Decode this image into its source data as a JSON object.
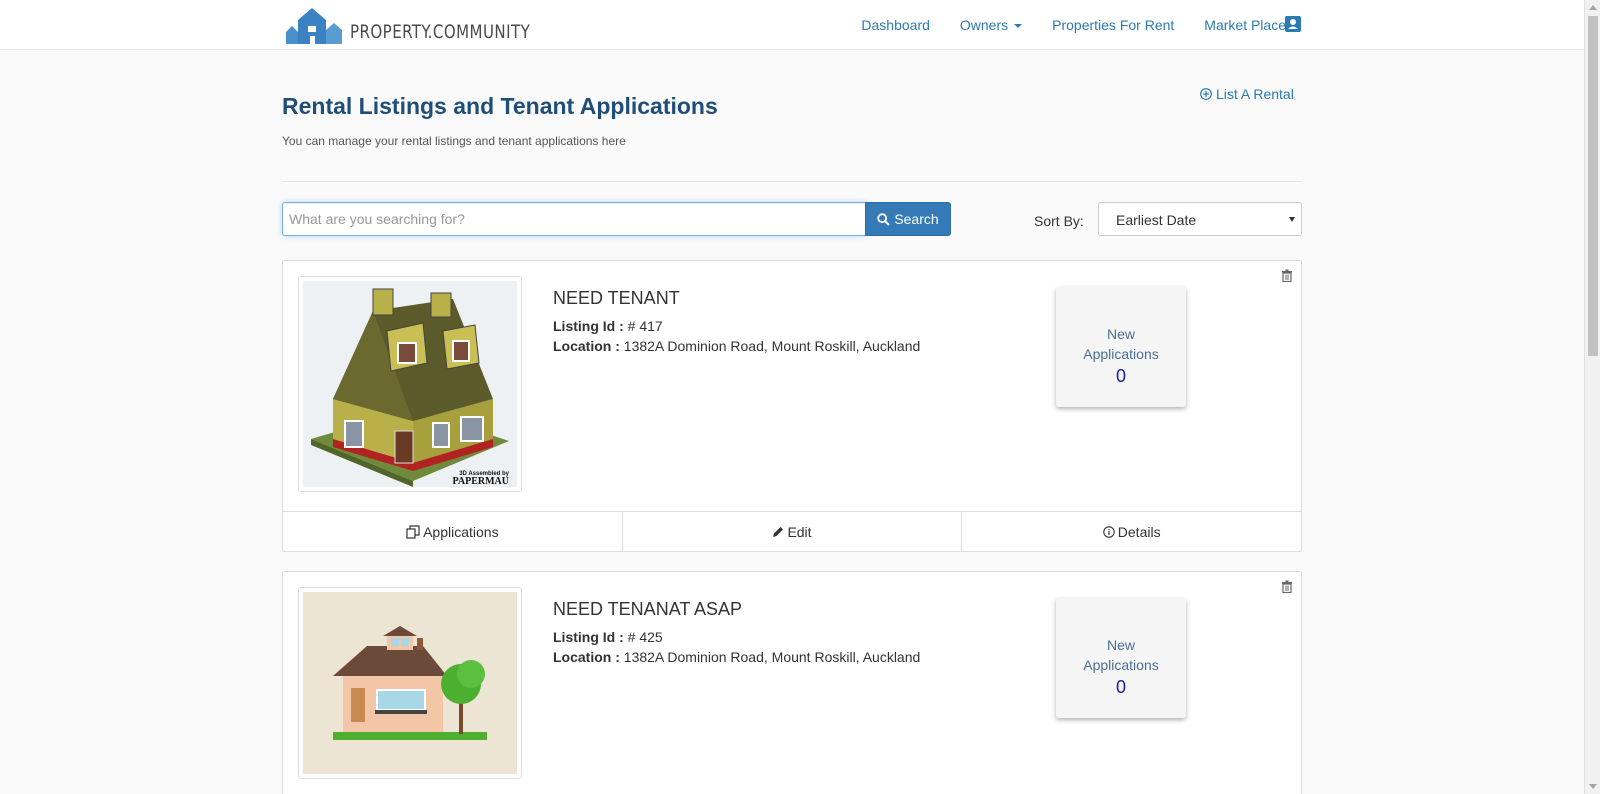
{
  "brand": {
    "name": "PROPERTY.COMMUNITY"
  },
  "nav": {
    "items": [
      "Dashboard",
      "Owners",
      "Properties For Rent",
      "Market Place"
    ]
  },
  "header": {
    "title": "Rental Listings and Tenant Applications",
    "subtitle": "You can manage your rental listings and tenant applications here",
    "list_rental": "List A Rental"
  },
  "search": {
    "placeholder": "What are you searching for?",
    "button": "Search",
    "sort_label": "Sort By:",
    "sort_value": "Earliest Date"
  },
  "listings": [
    {
      "title": "NEED TENANT",
      "id_label": "Listing Id :",
      "id_value": "# 417",
      "location_label": "Location :",
      "location_value": "1382A Dominion Road, Mount Roskill, Auckland",
      "apps_label": "New Applications",
      "apps_count": "0",
      "image_caption": "3D Assembled by PAPERMAU"
    },
    {
      "title": "NEED TENANAT ASAP",
      "id_label": "Listing Id :",
      "id_value": "# 425",
      "location_label": "Location :",
      "location_value": "1382A Dominion Road, Mount Roskill, Auckland",
      "apps_label": "New Applications",
      "apps_count": "0"
    }
  ],
  "actions": [
    "Applications",
    "Edit",
    "Details"
  ],
  "colors": {
    "link": "#2b7bb0",
    "primary": "#337ab7",
    "title": "#1f4e79"
  }
}
